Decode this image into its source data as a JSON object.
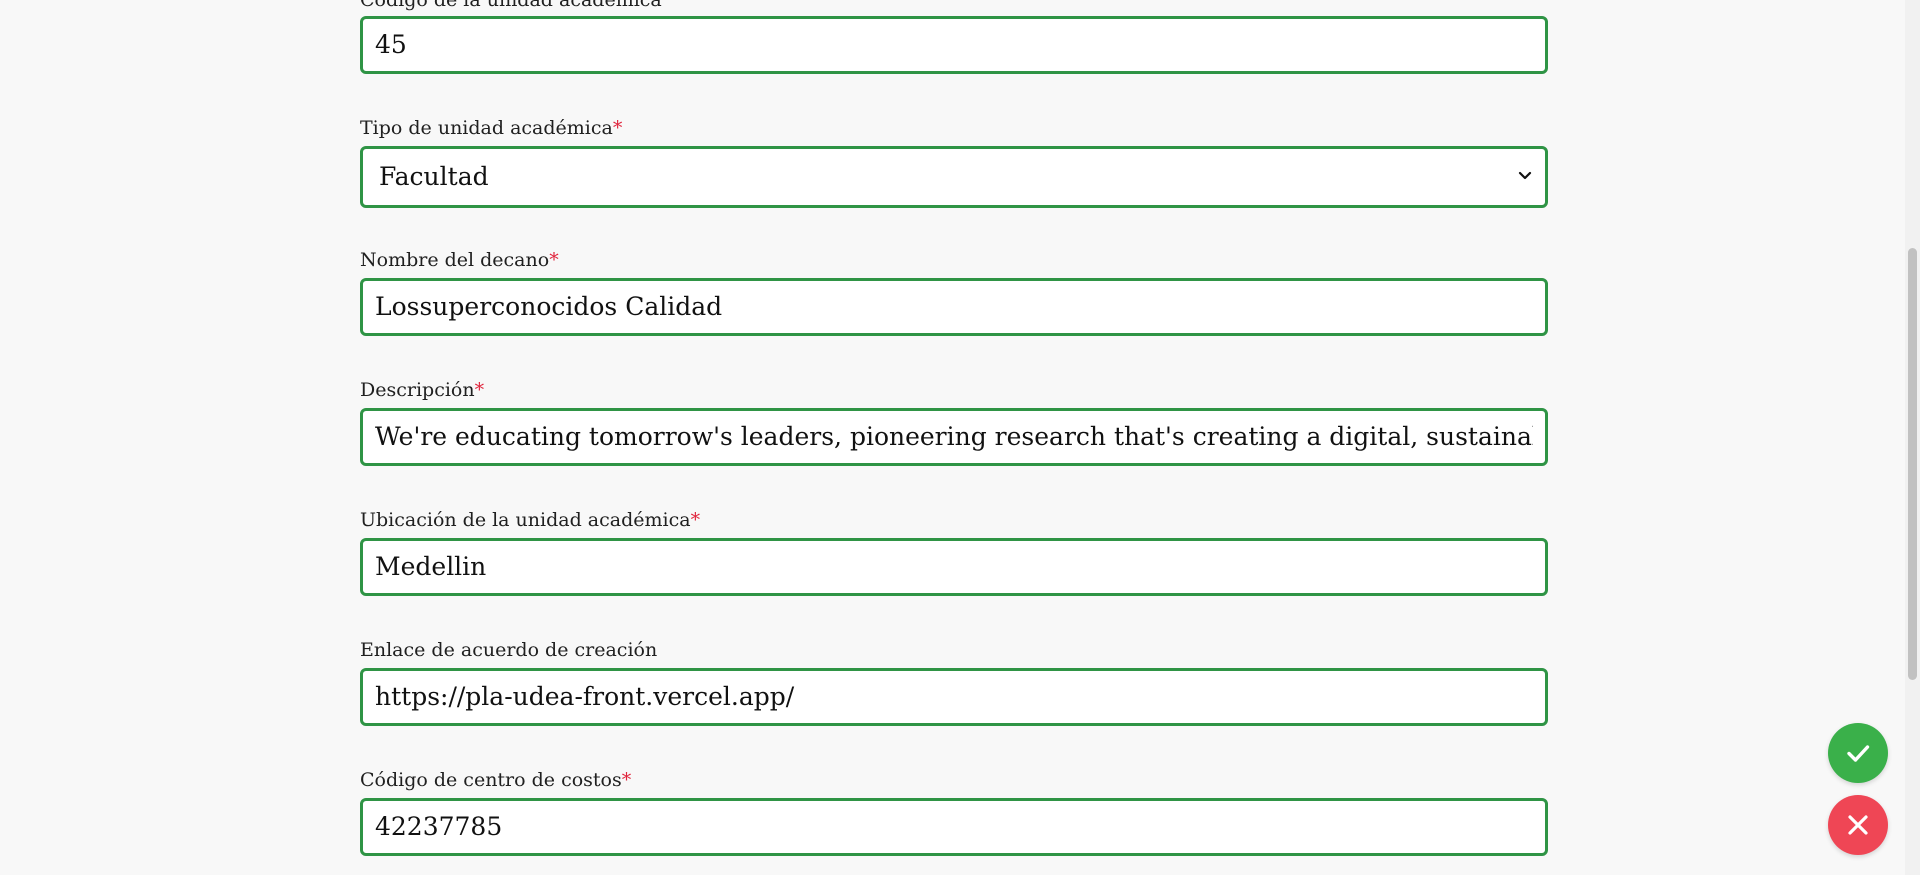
{
  "form": {
    "fields": [
      {
        "label": "Código de la unidad académica",
        "required": "",
        "value": "45"
      },
      {
        "label": "Tipo de unidad académica",
        "required": "*",
        "value": "Facultad"
      },
      {
        "label": "Nombre del decano",
        "required": "*",
        "value": "Lossuperconocidos Calidad"
      },
      {
        "label": "Descripción",
        "required": "*",
        "value": "We're educating tomorrow's leaders, pioneering research that's creating a digital, sustainable and h"
      },
      {
        "label": "Ubicación de la unidad académica",
        "required": "*",
        "value": "Medellin"
      },
      {
        "label": "Enlace de acuerdo de creación",
        "required": "",
        "value": "https://pla-udea-front.vercel.app/"
      },
      {
        "label": "Código de centro de costos",
        "required": "*",
        "value": "42237785"
      }
    ]
  },
  "actions": {
    "confirm_icon": "check-icon",
    "cancel_icon": "close-icon"
  },
  "colors": {
    "field_border": "#2f9445",
    "required_mark": "#e0243c",
    "confirm_button": "#3ab04a",
    "cancel_button": "#ef4655",
    "background": "#f8f8f8"
  }
}
